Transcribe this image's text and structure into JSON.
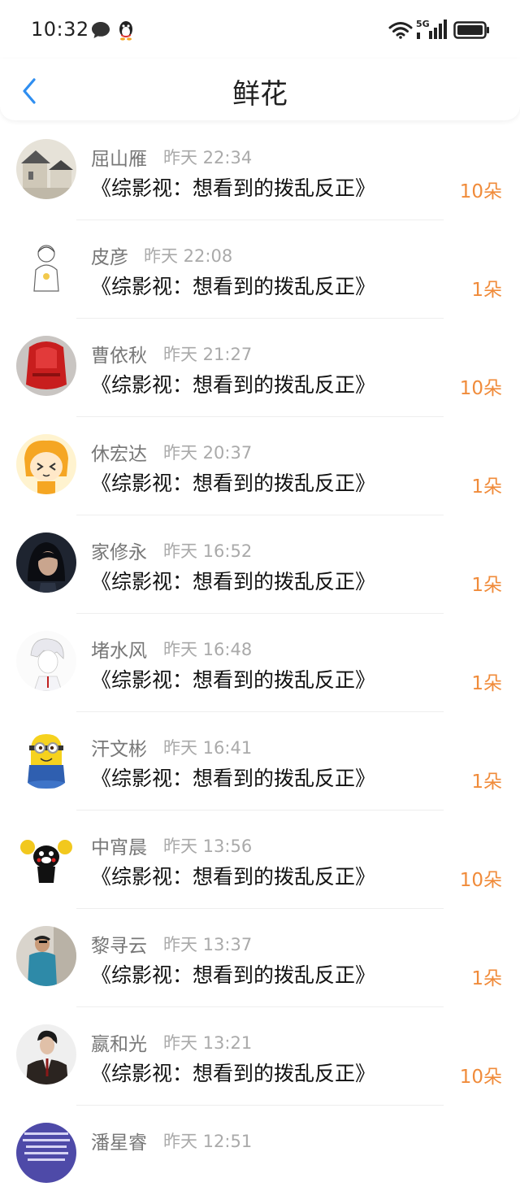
{
  "status_bar": {
    "time": "10:32",
    "network": "5G"
  },
  "header": {
    "title": "鲜花"
  },
  "items": [
    {
      "name": "屈山雁",
      "time": "昨天 22:34",
      "book": "《综影视：想看到的拨乱反正》",
      "count": "10朵",
      "avatar": "house-sketch"
    },
    {
      "name": "皮彦",
      "time": "昨天 22:08",
      "book": "《综影视：想看到的拨乱反正》",
      "count": "1朵",
      "avatar": "line-drawing-girl"
    },
    {
      "name": "曹依秋",
      "time": "昨天 21:27",
      "book": "《综影视：想看到的拨乱反正》",
      "count": "10朵",
      "avatar": "red-object"
    },
    {
      "name": "休宏达",
      "time": "昨天 20:37",
      "book": "《综影视：想看到的拨乱反正》",
      "count": "1朵",
      "avatar": "cartoon-fox"
    },
    {
      "name": "家修永",
      "time": "昨天 16:52",
      "book": "《综影视：想看到的拨乱反正》",
      "count": "1朵",
      "avatar": "dark-hair-girl"
    },
    {
      "name": "堵水风",
      "time": "昨天 16:48",
      "book": "《综影视：想看到的拨乱反正》",
      "count": "1朵",
      "avatar": "anime-boy"
    },
    {
      "name": "汗文彬",
      "time": "昨天 16:41",
      "book": "《综影视：想看到的拨乱反正》",
      "count": "1朵",
      "avatar": "minion"
    },
    {
      "name": "中宵晨",
      "time": "昨天 13:56",
      "book": "《综影视：想看到的拨乱反正》",
      "count": "10朵",
      "avatar": "kumamon"
    },
    {
      "name": "黎寻云",
      "time": "昨天 13:37",
      "book": "《综影视：想看到的拨乱反正》",
      "count": "1朵",
      "avatar": "man-photo"
    },
    {
      "name": "嬴和光",
      "time": "昨天 13:21",
      "book": "《综影视：想看到的拨乱反正》",
      "count": "10朵",
      "avatar": "suit-man"
    },
    {
      "name": "潘星睿",
      "time": "昨天 12:51",
      "book": "",
      "count": "",
      "avatar": "text-image"
    }
  ],
  "colors": {
    "accent": "#2f8ef0",
    "count": "#f08b3a"
  }
}
